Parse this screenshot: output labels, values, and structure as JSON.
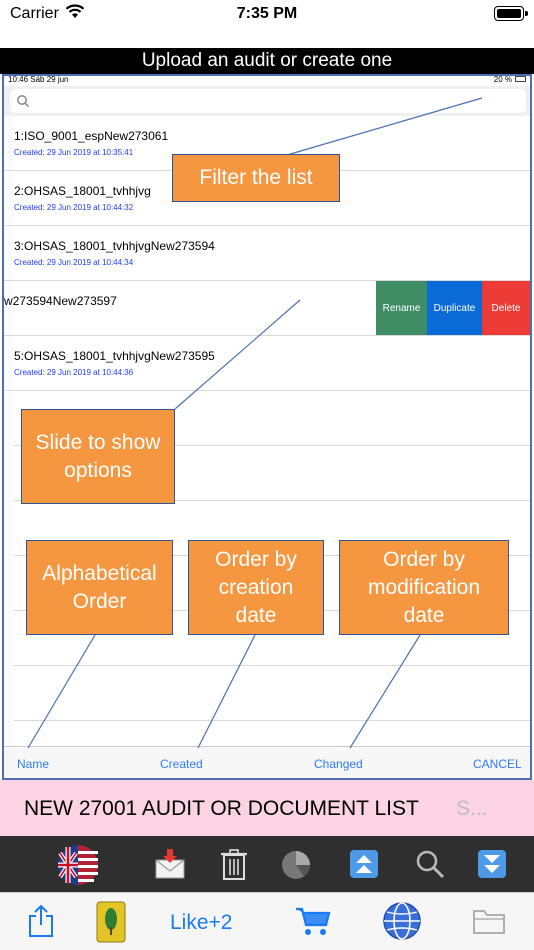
{
  "status_bar": {
    "carrier": "Carrier",
    "time": "7:35 PM"
  },
  "title": "Upload an audit or create one",
  "inner_status": {
    "time_date": "10:46  Sáb 29 jun",
    "battery": "20 %"
  },
  "rows": [
    {
      "title": "1:ISO_9001_espNew273061",
      "date": "Created: 29 Jun 2019 at 10:35:41"
    },
    {
      "title": "2:OHSAS_18001_tvhhjvg",
      "date": "Created: 29 Jun 2019 at 10:44:32"
    },
    {
      "title": "3:OHSAS_18001_tvhhjvgNew273594",
      "date": "Created: 29 Jun 2019 at 10:44:34"
    },
    {
      "title": "w273594New273597",
      "date": ""
    },
    {
      "title": "5:OHSAS_18001_tvhhjvgNew273595",
      "date": "Created: 29 Jun 2019 at 10:44:36"
    }
  ],
  "row_actions": {
    "rename": "Rename",
    "duplicate": "Duplicate",
    "delete": "Delete"
  },
  "sort_bar": {
    "name": "Name",
    "created": "Created",
    "changed": "Changed",
    "cancel": "CANCEL"
  },
  "callouts": {
    "filter": "Filter the list",
    "slide": "Slide to show\noptions",
    "alphabetical": "Alphabetical\nOrder",
    "creation": "Order by\ncreation\ndate",
    "modification": "Order by\nmodification\ndate"
  },
  "new_bar": {
    "label": "NEW 27001 AUDIT OR DOCUMENT LIST",
    "more": "S..."
  },
  "tab_bar": {
    "like": "Like+2"
  },
  "icons": [
    "flag-uk-us-icon",
    "mail-download-icon",
    "trash-icon",
    "pie-chart-icon",
    "move-top-icon",
    "search-icon",
    "move-bottom-icon",
    "share-icon",
    "app-logo-icon",
    "cart-icon",
    "globe-icon",
    "folder-icon"
  ],
  "colors": {
    "callout": "#f59640",
    "rename": "#3e8d64",
    "duplicate": "#0a6bd6",
    "delete": "#ed3b35",
    "link": "#2e7cf6",
    "new_bar": "#fbd3e2"
  }
}
